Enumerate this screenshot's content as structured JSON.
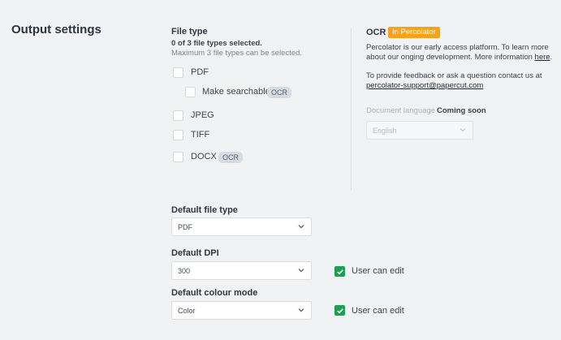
{
  "section": {
    "title": "Output settings"
  },
  "file_type": {
    "heading": "File type",
    "selected_count": "0 of 3 file types selected.",
    "max_note": "Maximum 3 file types can be selected.",
    "options": [
      {
        "label": "PDF",
        "checked": false
      },
      {
        "label": "Make searchable",
        "badge": "OCR",
        "checked": false
      },
      {
        "label": "JPEG",
        "checked": false
      },
      {
        "label": "TIFF",
        "checked": false
      },
      {
        "label": "DOCX",
        "badge": "OCR",
        "checked": false
      }
    ]
  },
  "ocr": {
    "title": "OCR",
    "pill": "In Percolator",
    "intro_text": "Percolator is our early access platform. To learn more about our onging development. More information ",
    "intro_link": "here",
    "intro_end": ".",
    "feedback_text": "To provide feedback or ask a question contact us at",
    "feedback_email": "percolator-support@papercut.com",
    "doc_language_label": "Document language",
    "coming_soon": "Coming soon",
    "language_value": "English"
  },
  "defaults": {
    "file_type_label": "Default file type",
    "file_type_value": "PDF",
    "dpi_label": "Default DPI",
    "dpi_value": "300",
    "colour_label": "Default colour mode",
    "colour_value": "Color",
    "user_can_edit": "User can edit"
  },
  "colors": {
    "accent_green": "#1f9d55",
    "pill_orange": "#f7a21b",
    "background": "#f1f2f4"
  }
}
